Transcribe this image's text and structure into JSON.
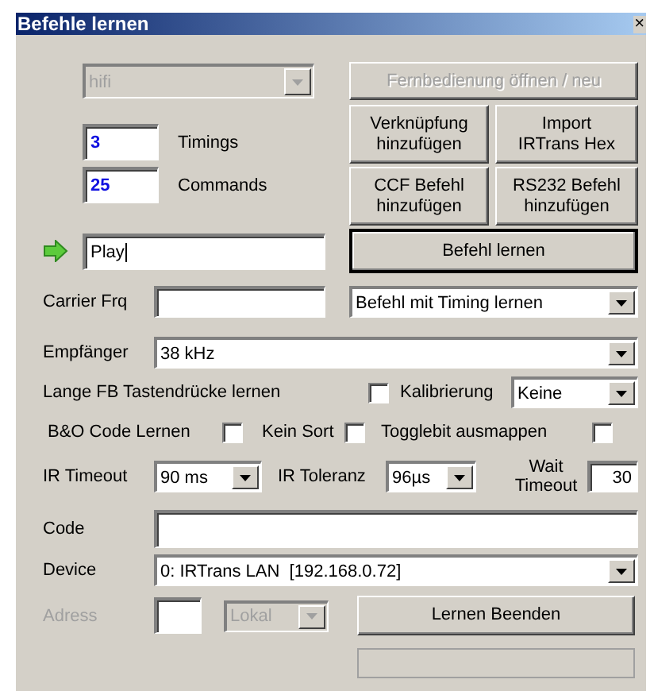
{
  "window": {
    "title": "Befehle lernen",
    "close": "×"
  },
  "remote": {
    "value": "hifi",
    "disabled": true
  },
  "open_remote_button": {
    "label": "Fernbedienung öffnen / neu",
    "disabled": true
  },
  "counters": [
    {
      "value": "3",
      "label": "Timings"
    },
    {
      "value": "25",
      "label": "Commands"
    }
  ],
  "add_buttons": [
    {
      "lines": [
        "Verknüpfung",
        "hinzufügen"
      ]
    },
    {
      "lines": [
        "Import",
        "IRTrans Hex"
      ]
    },
    {
      "lines": [
        "CCF Befehl",
        "hinzufügen"
      ]
    },
    {
      "lines": [
        "RS232 Befehl",
        "hinzufügen"
      ]
    }
  ],
  "command_name": {
    "value": "Play"
  },
  "learn_button": {
    "label": "Befehl lernen",
    "default": true
  },
  "carrier": {
    "label": "Carrier Frq"
  },
  "learn_mode": {
    "value": "Befehl mit Timing lernen"
  },
  "receiver": {
    "label": "Empfänger",
    "value": "38 kHz"
  },
  "long_press": {
    "label": "Lange FB Tastendrücke lernen",
    "checked": false
  },
  "calibration": {
    "label": "Kalibrierung",
    "value": "Keine"
  },
  "options": [
    {
      "label": "B&O Code Lernen",
      "checked": false
    },
    {
      "label": "Kein Sort",
      "checked": false
    },
    {
      "label": "Togglebit ausmappen",
      "checked": false
    }
  ],
  "ir_timeout": {
    "label": "IR Timeout",
    "value": "90 ms"
  },
  "ir_tolerance": {
    "label": "IR Toleranz",
    "value": "96µs"
  },
  "wait_timeout": {
    "label_lines": [
      "Wait",
      "Timeout"
    ],
    "value": "30"
  },
  "code": {
    "label": "Code"
  },
  "device": {
    "label": "Device",
    "value": "0: IRTrans LAN  [192.168.0.72]"
  },
  "address": {
    "label": "Adress",
    "disabled": true,
    "location": "Lokal",
    "location_disabled": true
  },
  "finish_button": {
    "label": "Lernen Beenden"
  },
  "status_field": {
    "kind": "empty"
  }
}
